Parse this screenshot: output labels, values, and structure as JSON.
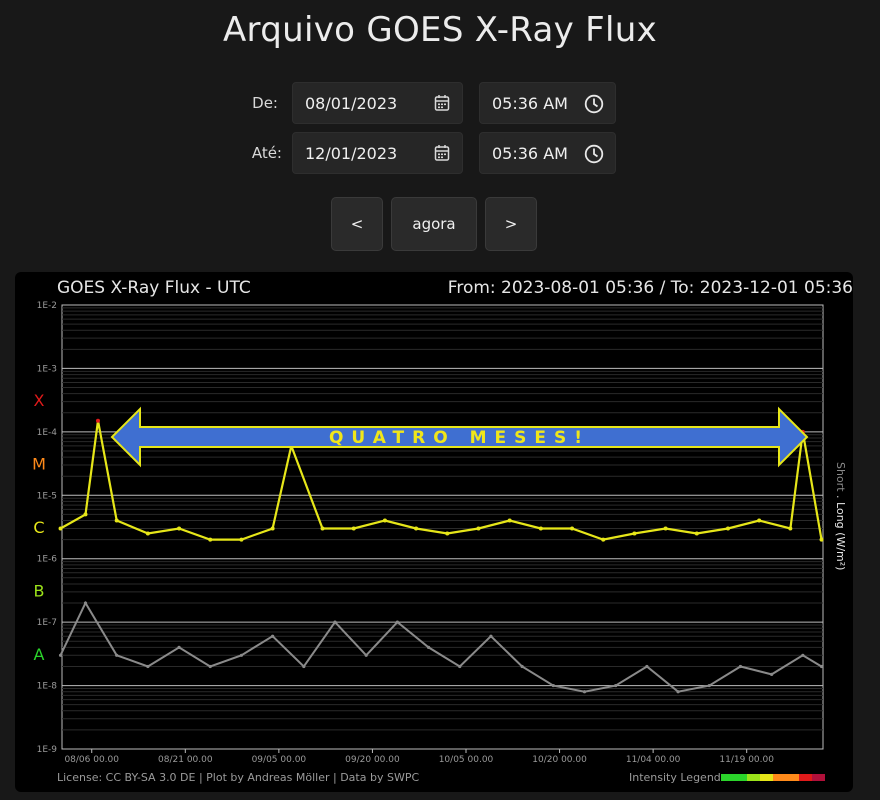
{
  "page": {
    "title": "Arquivo GOES X-Ray Flux"
  },
  "form": {
    "from": {
      "label": "De:",
      "date": "08/01/2023",
      "time": "05:36 AM"
    },
    "to": {
      "label": "Até:",
      "date": "12/01/2023",
      "time": "05:36 AM"
    },
    "nav": {
      "prev": "<",
      "now": "agora",
      "next": ">"
    }
  },
  "plot": {
    "title": "GOES X-Ray Flux - UTC",
    "range": "From: 2023-08-01 05:36  /  To: 2023-12-01 05:36",
    "right_axis_short": "Short",
    "right_axis_long": "Long (W/m²)",
    "footer": "License: CC BY-SA 3.0 DE | Plot by Andreas Möller | Data by SWPC",
    "legend_label": "Intensity Legend",
    "annotation": "QUATRO  MESES!",
    "colors": {
      "A": "#2bd42b",
      "B": "#9be21a",
      "C": "#e6e619",
      "M": "#ff8a1a",
      "X": "#e01a1a",
      "long": "#e6e619",
      "short": "#8a8a8a",
      "arrow_fill": "#3f6fd1",
      "arrow_stroke": "#e6e619"
    }
  },
  "chart_data": {
    "type": "line",
    "title": "GOES X-Ray Flux - UTC",
    "ylabel": "Long (W/m²)",
    "y_scale": "log",
    "ylim": [
      1e-09,
      0.01
    ],
    "y_ticks": [
      "1E-2",
      "1E-3",
      "1E-4",
      "1E-5",
      "1E-6",
      "1E-7",
      "1E-8",
      "1E-9"
    ],
    "y_tick_values": [
      0.01,
      0.001,
      0.0001,
      1e-05,
      1e-06,
      1e-07,
      1e-08,
      1e-09
    ],
    "flare_classes": [
      {
        "name": "X",
        "value": 0.000316
      },
      {
        "name": "M",
        "value": 3.16e-05
      },
      {
        "name": "C",
        "value": 3.16e-06
      },
      {
        "name": "B",
        "value": 3.16e-07
      },
      {
        "name": "A",
        "value": 3.16e-08
      }
    ],
    "x_range": [
      "2023-08-01 05:36",
      "2023-12-01 05:36"
    ],
    "x_ticks": [
      "08/06 00.00",
      "08/21 00.00",
      "09/05 00.00",
      "09/20 00.00",
      "10/05 00.00",
      "10/20 00.00",
      "11/04 00.00",
      "11/19 00.00"
    ],
    "x_tick_dates": [
      "2023-08-06",
      "2023-08-21",
      "2023-09-05",
      "2023-09-20",
      "2023-10-05",
      "2023-10-20",
      "2023-11-04",
      "2023-11-19"
    ],
    "series": [
      {
        "name": "Long (W/m²)",
        "x": [
          "2023-08-01",
          "2023-08-05",
          "2023-08-07",
          "2023-08-10",
          "2023-08-15",
          "2023-08-20",
          "2023-08-25",
          "2023-08-30",
          "2023-09-04",
          "2023-09-07",
          "2023-09-12",
          "2023-09-17",
          "2023-09-22",
          "2023-09-27",
          "2023-10-02",
          "2023-10-07",
          "2023-10-12",
          "2023-10-17",
          "2023-10-22",
          "2023-10-27",
          "2023-11-01",
          "2023-11-06",
          "2023-11-11",
          "2023-11-16",
          "2023-11-21",
          "2023-11-26",
          "2023-11-28",
          "2023-12-01"
        ],
        "y": [
          3e-06,
          5e-06,
          0.00015,
          4e-06,
          2.5e-06,
          3e-06,
          2e-06,
          2e-06,
          3e-06,
          6e-05,
          3e-06,
          3e-06,
          4e-06,
          3e-06,
          2.5e-06,
          3e-06,
          4e-06,
          3e-06,
          3e-06,
          2e-06,
          2.5e-06,
          3e-06,
          2.5e-06,
          3e-06,
          4e-06,
          3e-06,
          0.0001,
          2e-06
        ]
      },
      {
        "name": "Short",
        "x": [
          "2023-08-01",
          "2023-08-05",
          "2023-08-10",
          "2023-08-15",
          "2023-08-20",
          "2023-08-25",
          "2023-08-30",
          "2023-09-04",
          "2023-09-09",
          "2023-09-14",
          "2023-09-19",
          "2023-09-24",
          "2023-09-29",
          "2023-10-04",
          "2023-10-09",
          "2023-10-14",
          "2023-10-19",
          "2023-10-24",
          "2023-10-29",
          "2023-11-03",
          "2023-11-08",
          "2023-11-13",
          "2023-11-18",
          "2023-11-23",
          "2023-11-28",
          "2023-12-01"
        ],
        "y": [
          3e-08,
          2e-07,
          3e-08,
          2e-08,
          4e-08,
          2e-08,
          3e-08,
          6e-08,
          2e-08,
          1e-07,
          3e-08,
          1e-07,
          4e-08,
          2e-08,
          6e-08,
          2e-08,
          1e-08,
          8e-09,
          1e-08,
          2e-08,
          8e-09,
          1e-08,
          2e-08,
          1.5e-08,
          3e-08,
          2e-08
        ]
      }
    ],
    "grid": true,
    "legend": "bottom-right"
  }
}
